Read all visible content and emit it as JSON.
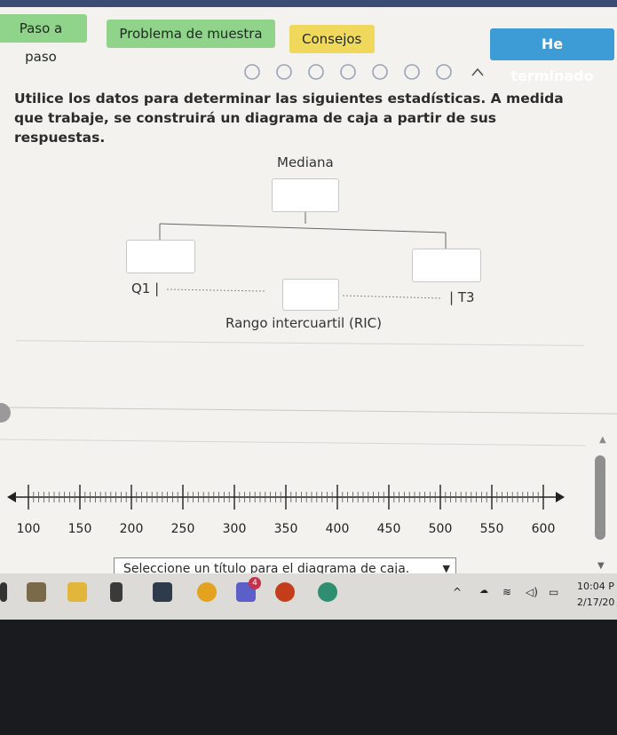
{
  "toolbar": {
    "paso_label": "Paso a paso",
    "muestra_label": "Problema de muestra",
    "consejos_label": "Consejos",
    "done_label": "He terminado"
  },
  "instructions": "Utilice los datos para determinar las siguientes estadísticas. A medida que trabaje, se construirá un diagrama de caja a partir de sus respuestas.",
  "diagram": {
    "median_label": "Mediana",
    "q1_label": "Q1",
    "q3_label": "T3",
    "iqr_label": "Rango intercuartil (RIC)"
  },
  "number_line": {
    "min": 100,
    "max": 600,
    "major_step": 50,
    "tick_labels": [
      "100",
      "150",
      "200",
      "250",
      "300",
      "350",
      "400",
      "450",
      "500",
      "550",
      "600"
    ]
  },
  "title_select": {
    "placeholder": "Seleccione un título para el diagrama de caja."
  },
  "taskbar": {
    "time": "10:04 P",
    "date": "2/17/20",
    "badge": "4"
  },
  "colors": {
    "green": "#8fd48a",
    "yellow": "#f0d85c",
    "blue": "#3d9bd6"
  }
}
